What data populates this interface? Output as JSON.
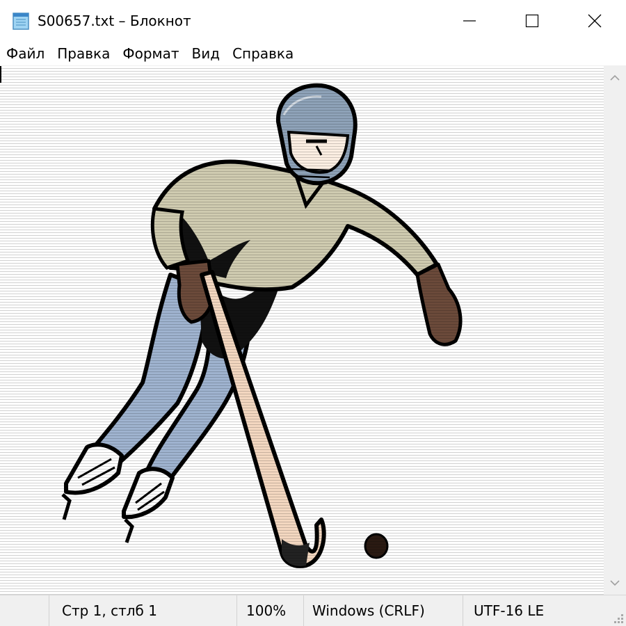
{
  "window": {
    "title": "S00657.txt – Блокнот",
    "icon": "notepad-icon",
    "controls": [
      "minimize-icon",
      "maximize-icon",
      "close-icon"
    ]
  },
  "menu": {
    "items": [
      "Файл",
      "Правка",
      "Формат",
      "Вид",
      "Справка"
    ]
  },
  "editor": {
    "content_description_icon": "hockey-player-ascii-picture"
  },
  "status": {
    "position": "Стр 1, стлб 1",
    "zoom": "100%",
    "line_ending": "Windows (CRLF)",
    "encoding": "UTF-16 LE"
  },
  "colors": {
    "helmet": "#8ea2b8",
    "jersey": "#cfcbb0",
    "pants": "#9fb3cf",
    "stick": "#f3d7c0",
    "glove": "#6b4a3a",
    "outline": "#000000",
    "chrome_bg": "#f0f0f0"
  }
}
